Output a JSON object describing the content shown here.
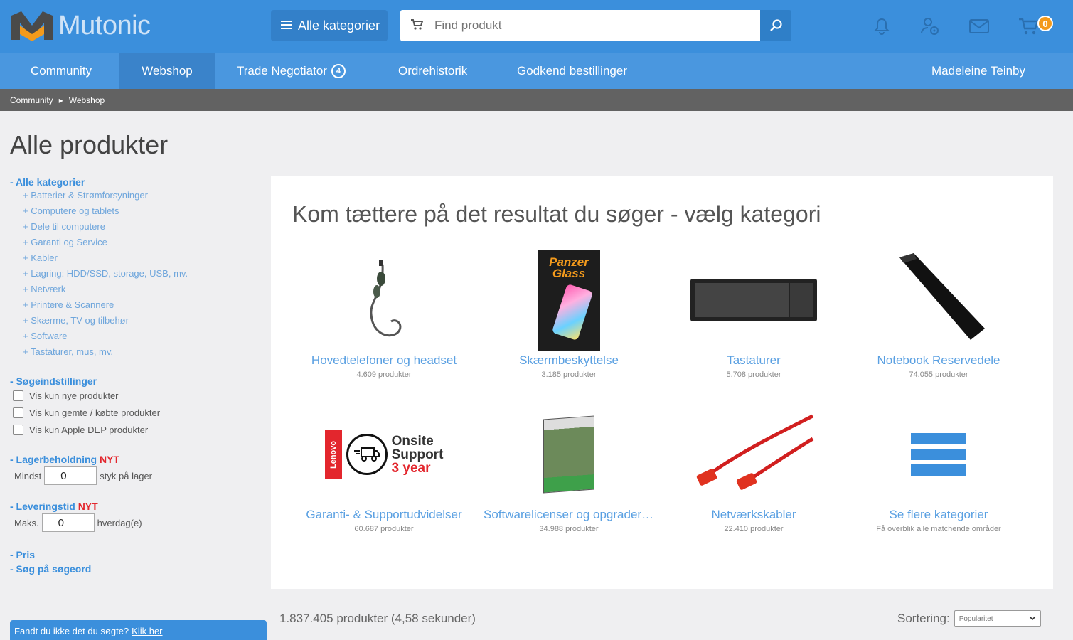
{
  "header": {
    "brand": "Mutonic",
    "category_button": "Alle kategorier",
    "search_placeholder": "Find produkt",
    "cart_count": "0"
  },
  "nav": {
    "items": [
      "Community",
      "Webshop",
      "Trade Negotiator",
      "Ordrehistorik",
      "Godkend bestillinger"
    ],
    "trade_badge": "4",
    "user": "Madeleine Teinby"
  },
  "breadcrumb": [
    "Community",
    "Webshop"
  ],
  "page": {
    "title": "Alle produkter"
  },
  "sidebar": {
    "categories_head": "- Alle kategorier",
    "categories": [
      "+ Batterier & Strømforsyninger",
      "+ Computere og tablets",
      "+ Dele til computere",
      "+ Garanti og Service",
      "+ Kabler",
      "+ Lagring: HDD/SSD, storage, USB, mv.",
      "+ Netværk",
      "+ Printere & Scannere",
      "+ Skærme, TV og tilbehør",
      "+ Software",
      "+ Tastaturer, mus, mv."
    ],
    "search_settings_head": "- Søgeindstillinger",
    "checkboxes": [
      "Vis kun nye produkter",
      "Vis kun gemte / købte produkter",
      "Vis kun Apple DEP produkter"
    ],
    "stock_head": "- Lagerbeholdning",
    "new_tag": "NYT",
    "stock_prefix": "Mindst",
    "stock_value": "0",
    "stock_suffix": "styk på lager",
    "delivery_head": "- Leveringstid",
    "delivery_prefix": "Maks.",
    "delivery_value": "0",
    "delivery_suffix": "hverdag(e)",
    "price_head": "- Pris",
    "keyword_head": "- Søg på søgeord",
    "feedback_text": "Fandt du ikke det du søgte?",
    "feedback_link": "Klik her"
  },
  "main": {
    "title": "Kom tættere på det resultat du søger - vælg kategori",
    "tiles": [
      {
        "name": "Hovedtelefoner og headset",
        "count": "4.609 produkter"
      },
      {
        "name": "Skærmbeskyttelse",
        "count": "3.185 produkter"
      },
      {
        "name": "Tastaturer",
        "count": "5.708 produkter"
      },
      {
        "name": "Notebook Reservedele",
        "count": "74.055 produkter"
      },
      {
        "name": "Garanti- & Supportudvidelser",
        "count": "60.687 produkter"
      },
      {
        "name": "Softwarelicenser og opgraderi...",
        "count": "34.988 produkter"
      },
      {
        "name": "Netværkskabler",
        "count": "22.410 produkter"
      },
      {
        "name": "Se flere kategorier",
        "count": "Få overblik alle matchende områder"
      }
    ],
    "panzer_line1": "Panzer",
    "panzer_line2": "Glass",
    "lenovo_text": "Lenovo",
    "onsite_line1": "Onsite",
    "onsite_line2": "Support",
    "onsite_line3": "3 year"
  },
  "results": {
    "count_text": "1.837.405 produkter (4,58 sekunder)",
    "sort_label": "Sortering:",
    "sort_value": "Popularitet"
  }
}
